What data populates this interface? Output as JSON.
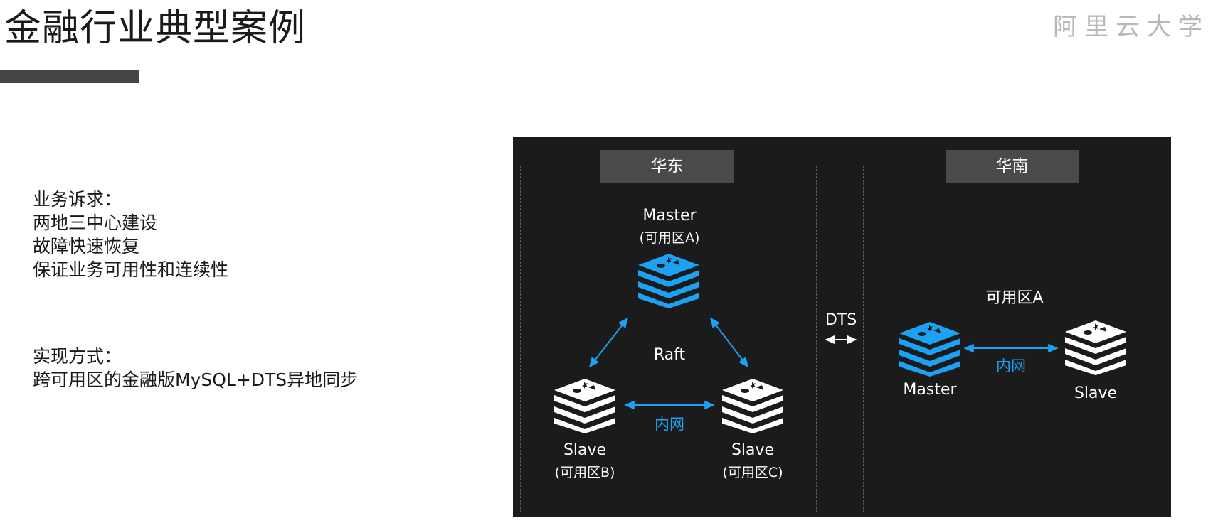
{
  "header": {
    "title": "金融行业典型案例",
    "brand": "阿里云大学"
  },
  "requirements": {
    "heading": "业务诉求：",
    "items": [
      "两地三中心建设",
      "故障快速恢复",
      "保证业务可用性和连续性"
    ]
  },
  "implementation": {
    "heading": "实现方式：",
    "items": [
      "跨可用区的金融版MySQL+DTS异地同步"
    ]
  },
  "diagram": {
    "colors": {
      "panel": "#1b1b1b",
      "accent": "#1da1f2",
      "white": "#ffffff"
    },
    "east": {
      "tab": "华东",
      "master_label": "Master",
      "master_zone": "(可用区A)",
      "slave_b_label": "Slave",
      "slave_b_zone": "(可用区B)",
      "slave_c_label": "Slave",
      "slave_c_zone": "(可用区C)",
      "protocol": "Raft",
      "link": "内网"
    },
    "sync": {
      "label": "DTS"
    },
    "south": {
      "tab": "华南",
      "zone": "可用区A",
      "master_label": "Master",
      "slave_label": "Slave",
      "link": "内网"
    }
  }
}
